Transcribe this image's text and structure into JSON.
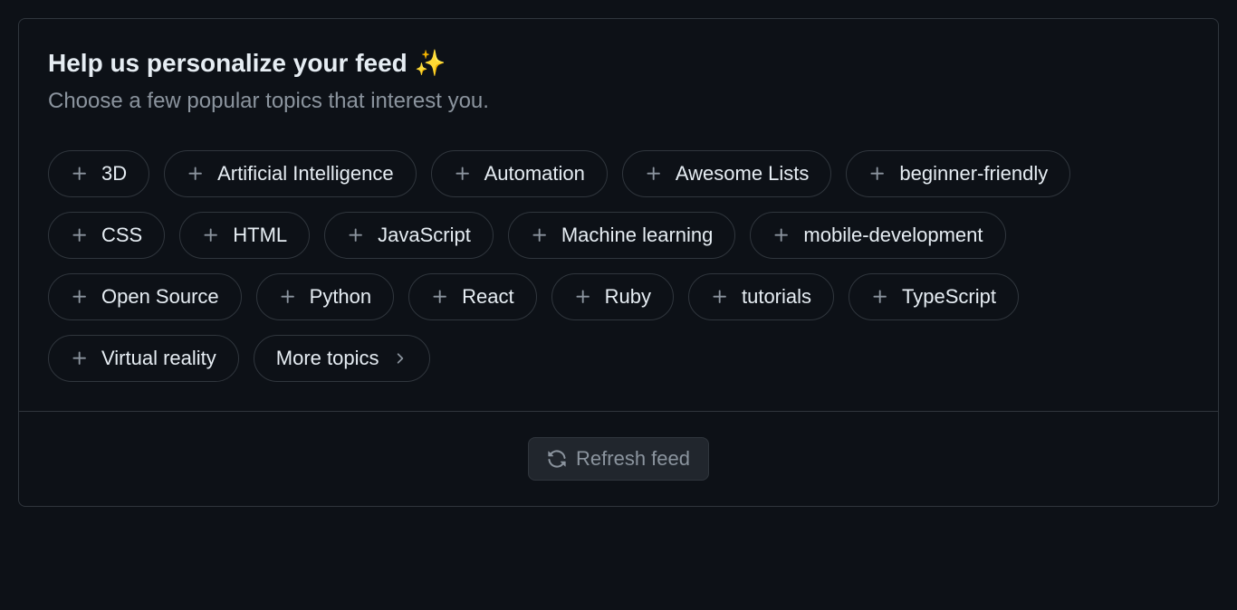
{
  "header": {
    "title": "Help us personalize your feed ✨",
    "subtitle": "Choose a few popular topics that interest you."
  },
  "topics": [
    {
      "label": "3D"
    },
    {
      "label": "Artificial Intelligence"
    },
    {
      "label": "Automation"
    },
    {
      "label": "Awesome Lists"
    },
    {
      "label": "beginner-friendly"
    },
    {
      "label": "CSS"
    },
    {
      "label": "HTML"
    },
    {
      "label": "JavaScript"
    },
    {
      "label": "Machine learning"
    },
    {
      "label": "mobile-development"
    },
    {
      "label": "Open Source"
    },
    {
      "label": "Python"
    },
    {
      "label": "React"
    },
    {
      "label": "Ruby"
    },
    {
      "label": "tutorials"
    },
    {
      "label": "TypeScript"
    },
    {
      "label": "Virtual reality"
    }
  ],
  "moreTopics": {
    "label": "More topics"
  },
  "footer": {
    "refreshLabel": "Refresh feed"
  }
}
